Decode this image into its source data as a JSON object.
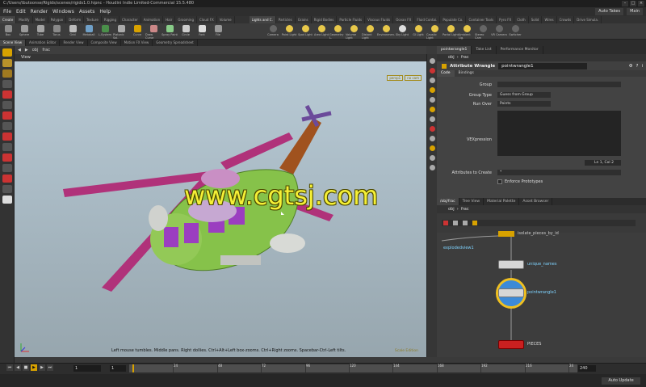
{
  "app": {
    "title": "C:/Users/tbutoonse/Rigids/scenes/rigids1.0.hipnc - Houdini Indie Limited-Commercial 15.5.480",
    "desktop": "Main",
    "auto_takes": "Auto Takes"
  },
  "menu": [
    "File",
    "Edit",
    "Render",
    "Windows",
    "Assets",
    "Help"
  ],
  "shelf_tabs": {
    "left": [
      "Create",
      "Modify",
      "Model",
      "Polygon",
      "Deform",
      "Texture",
      "Rigging",
      "Character",
      "Animation",
      "Hair",
      "Grooming",
      "Cloud FX",
      "Volume"
    ],
    "right": [
      "Lights and C.",
      "Particles",
      "Grains",
      "Rigid Bodies",
      "Particle Fluids",
      "Viscous Fluids",
      "Ocean FX",
      "Fluid Contai.",
      "Populate Co.",
      "Container Tools",
      "Pyro FX",
      "Cloth",
      "Solid",
      "Wires",
      "Crowds",
      "Drive Simula."
    ]
  },
  "shelf_tools": {
    "left": [
      "Box",
      "Sphere",
      "Tube",
      "Torus",
      "Grid",
      "Metaball",
      "L-System",
      "Platonic Sol.",
      "Curve",
      "Draw Curve",
      "Spray Paint",
      "Circle",
      "Font",
      "File"
    ],
    "right": [
      "Camera",
      "Point Light",
      "Spot Light",
      "Area Light",
      "Geometry L.",
      "Volume Light",
      "Distant Light",
      "Environmen.",
      "Sky Light",
      "GI Light",
      "Caustic Light",
      "Portal Light",
      "Ambient Lig.",
      "Stereo Cam",
      "VR Camera",
      "Switcher"
    ]
  },
  "pane_tabs": [
    "Scene View",
    "Animation Editor",
    "Render View",
    "Composite View",
    "Motion FX View",
    "Geometry Spreadsheet"
  ],
  "viewer": {
    "path": [
      "obj",
      "frac"
    ],
    "label": "View",
    "cam_chips": [
      "persp1",
      "no cam"
    ],
    "hint": "Left mouse tumbles. Middle pans. Right dollies. Ctrl+Alt+Left box-zooms. Ctrl+Right zooms. Spacebar-Ctrl-Left tilts.",
    "state": "Scale Edition"
  },
  "watermark": "www.cgtsj.com",
  "timeline": {
    "current_frame": "1",
    "start_frame": "1",
    "end_frame": "240",
    "ticks": [
      "24",
      "48",
      "72",
      "96",
      "120",
      "144",
      "168",
      "192",
      "216",
      "24"
    ],
    "auto_update": "Auto Update"
  },
  "parm_pane": {
    "tabs": [
      "pointwrangle1",
      "Take List",
      "Performance Monitor"
    ],
    "path": [
      "obj",
      "frac"
    ],
    "node_type": "Attribute Wrangle",
    "node_name": "pointwrangle1",
    "subtabs": [
      "Code",
      "Bindings"
    ],
    "group_label": "Group",
    "group_type_label": "Group Type",
    "group_type_value": "Guess from Group",
    "run_over_label": "Run Over",
    "run_over_value": "Points",
    "vex_label": "VEXpression",
    "vex_value": "",
    "cursor_pos": "Ln 1, Col 2",
    "attr_create_label": "Attributes to Create",
    "attr_create_value": "*",
    "enforce_label": "Enforce Prototypes"
  },
  "network": {
    "tabs": [
      "/obj/frac",
      "Tree View",
      "Material Palette",
      "Asset Browser"
    ],
    "path": [
      "obj",
      "frac"
    ],
    "nodes": [
      {
        "label": "explodedview1"
      },
      {
        "label": "unique_names"
      },
      {
        "label": "pointwrangle1"
      },
      {
        "label": "PIECES"
      }
    ],
    "top_note": "isolate_pieces_by_id"
  },
  "colors": {
    "accent": "#d8a200",
    "watermark": "#f5f036",
    "node_wire": "#7fd3ff",
    "selected_node": "#f0c020"
  }
}
